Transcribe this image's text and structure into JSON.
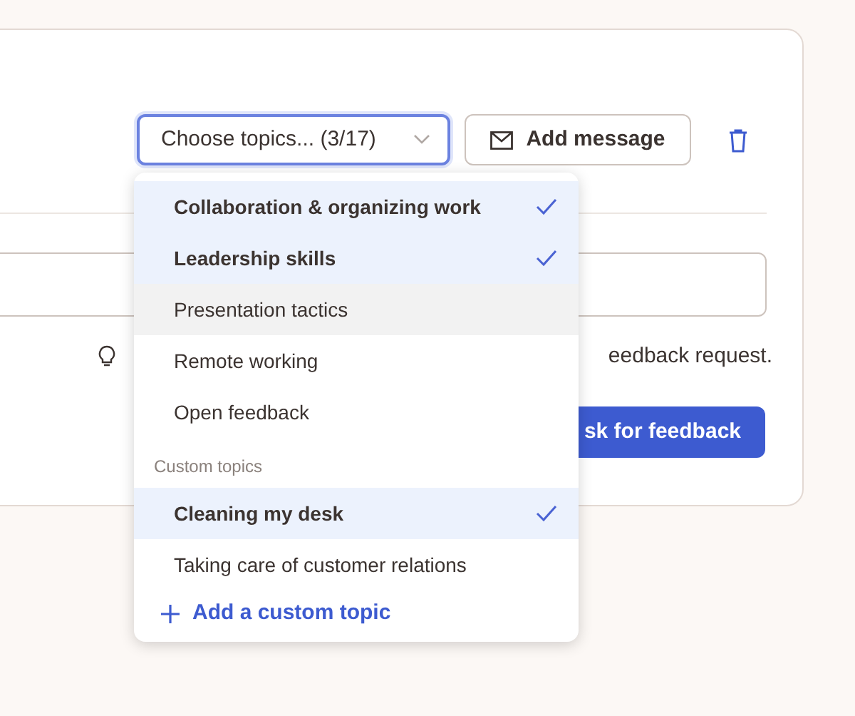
{
  "toolbar": {
    "topic_select": {
      "value": "Choose topics... (3/17)",
      "expanded": true
    },
    "add_message": "Add message"
  },
  "hint": {
    "end": "eedback request."
  },
  "submit": "sk for feedback",
  "menu": {
    "topics": [
      {
        "label": "Collaboration & organizing work",
        "selected": true,
        "highlighted": false
      },
      {
        "label": "Leadership skills",
        "selected": true,
        "highlighted": false
      },
      {
        "label": "Presentation tactics",
        "selected": false,
        "highlighted": true
      },
      {
        "label": "Remote working",
        "selected": false,
        "highlighted": false
      },
      {
        "label": "Open feedback",
        "selected": false,
        "highlighted": false
      }
    ],
    "custom_heading": "Custom topics",
    "custom_topics": [
      {
        "label": "Cleaning my desk",
        "selected": true,
        "highlighted": false
      },
      {
        "label": "Taking care of customer relations",
        "selected": false,
        "highlighted": false
      }
    ],
    "add_topic": "Add a custom topic"
  }
}
